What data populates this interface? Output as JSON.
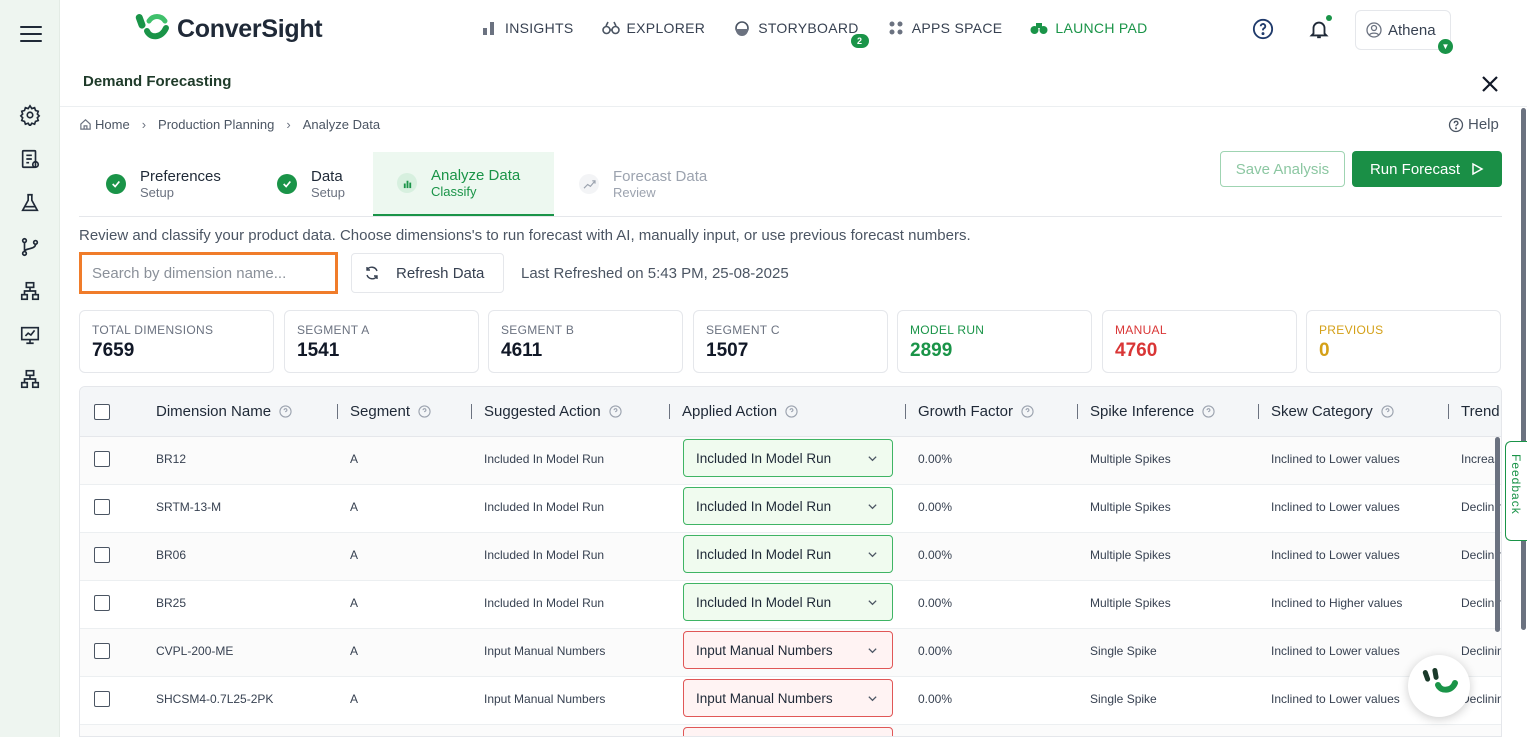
{
  "app": {
    "brand": "ConverSight",
    "nav": [
      {
        "label": "INSIGHTS",
        "icon": "bar-chart-icon"
      },
      {
        "label": "EXPLORER",
        "icon": "binoculars-icon"
      },
      {
        "label": "STORYBOARD",
        "icon": "storyboard-icon",
        "badge": "2"
      },
      {
        "label": "APPS SPACE",
        "icon": "apps-grid-icon"
      },
      {
        "label": "LAUNCH PAD",
        "icon": "binoculars-icon"
      }
    ],
    "user": "Athena",
    "colors": {
      "accent": "#1a9448",
      "manual": "#d93636",
      "previous": "#d4a017",
      "highlight": "#f07c2a"
    }
  },
  "panel": {
    "title": "Demand Forecasting",
    "help": "Help",
    "breadcrumb": [
      "Home",
      "Production Planning",
      "Analyze Data"
    ],
    "steps": [
      {
        "title": "Preferences",
        "sub": "Setup",
        "state": "done"
      },
      {
        "title": "Data",
        "sub": "Setup",
        "state": "done"
      },
      {
        "title": "Analyze Data",
        "sub": "Classify",
        "state": "active"
      },
      {
        "title": "Forecast Data",
        "sub": "Review",
        "state": "pending"
      }
    ],
    "save_label": "Save Analysis",
    "run_label": "Run Forecast",
    "description": "Review and classify your product data. Choose dimensions's to run forecast with AI, manually input, or use previous forecast numbers.",
    "search_placeholder": "Search by dimension name...",
    "refresh_label": "Refresh Data",
    "last_refreshed": "Last Refreshed on 5:43 PM, 25-08-2025"
  },
  "stats": [
    {
      "label": "TOTAL DIMENSIONS",
      "value": "7659"
    },
    {
      "label": "SEGMENT A",
      "value": "1541"
    },
    {
      "label": "SEGMENT B",
      "value": "4611"
    },
    {
      "label": "SEGMENT C",
      "value": "1507"
    },
    {
      "label": "MODEL RUN",
      "value": "2899"
    },
    {
      "label": "MANUAL",
      "value": "4760"
    },
    {
      "label": "PREVIOUS",
      "value": "0"
    }
  ],
  "table": {
    "columns": [
      "Dimension Name",
      "Segment",
      "Suggested Action",
      "Applied Action",
      "Growth Factor",
      "Spike Inference",
      "Skew Category",
      "Trend"
    ],
    "rows": [
      {
        "name": "BR12",
        "segment": "A",
        "suggested": "Included In Model Run",
        "applied": "Included In Model Run",
        "type": "green",
        "growth": "0.00%",
        "spike": "Multiple Spikes",
        "skew": "Inclined to Lower values",
        "trend": "Increasing"
      },
      {
        "name": "SRTM-13-M",
        "segment": "A",
        "suggested": "Included In Model Run",
        "applied": "Included In Model Run",
        "type": "green",
        "growth": "0.00%",
        "spike": "Multiple Spikes",
        "skew": "Inclined to Lower values",
        "trend": "Declining"
      },
      {
        "name": "BR06",
        "segment": "A",
        "suggested": "Included In Model Run",
        "applied": "Included In Model Run",
        "type": "green",
        "growth": "0.00%",
        "spike": "Multiple Spikes",
        "skew": "Inclined to Lower values",
        "trend": "Declining"
      },
      {
        "name": "BR25",
        "segment": "A",
        "suggested": "Included In Model Run",
        "applied": "Included In Model Run",
        "type": "green",
        "growth": "0.00%",
        "spike": "Multiple Spikes",
        "skew": "Inclined to Higher values",
        "trend": "Declining"
      },
      {
        "name": "CVPL-200-ME",
        "segment": "A",
        "suggested": "Input Manual Numbers",
        "applied": "Input Manual Numbers",
        "type": "red",
        "growth": "0.00%",
        "spike": "Single Spike",
        "skew": "Inclined to Lower values",
        "trend": "Declining"
      },
      {
        "name": "SHCSM4-0.7L25-2PK",
        "segment": "A",
        "suggested": "Input Manual Numbers",
        "applied": "Input Manual Numbers",
        "type": "red",
        "growth": "0.00%",
        "spike": "Single Spike",
        "skew": "Inclined to Lower values",
        "trend": "Declining"
      }
    ]
  },
  "feedback": "Feedback"
}
